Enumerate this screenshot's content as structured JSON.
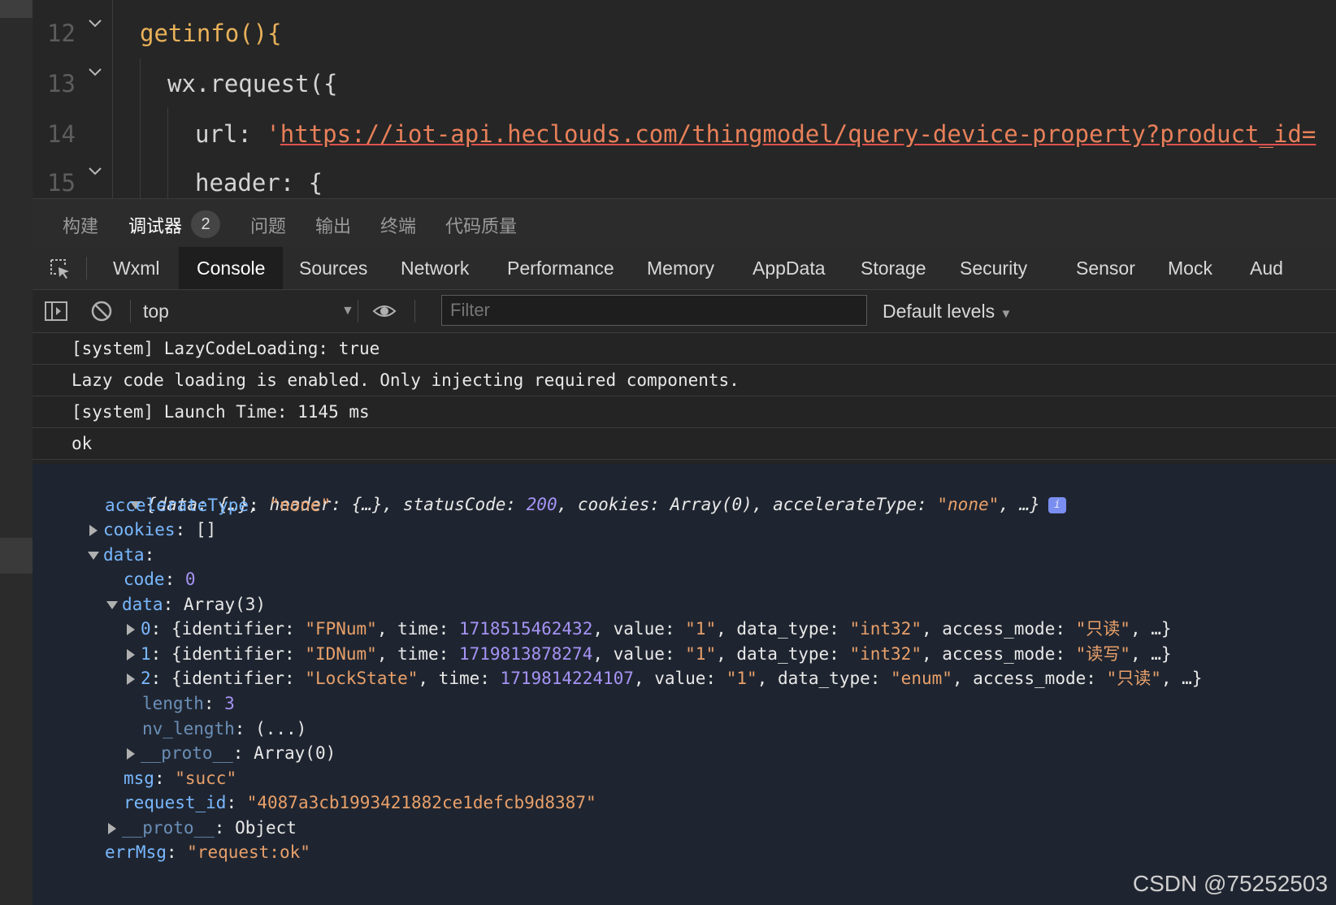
{
  "editor": {
    "lines": [
      {
        "num": "12",
        "code": "getinfo(){"
      },
      {
        "num": "13",
        "code": "wx.request({"
      },
      {
        "num": "14",
        "code_key": "url: ",
        "code_quote": "'",
        "code_url": "https://iot-api.heclouds.com/thingmodel/query-device-property?product_id="
      },
      {
        "num": "15",
        "code": "header: {"
      }
    ]
  },
  "panel_tabs": {
    "build": "构建",
    "debugger": "调试器",
    "debugger_badge": "2",
    "problems": "问题",
    "output": "输出",
    "terminal": "终端",
    "code_quality": "代码质量"
  },
  "dev_tabs": [
    "Wxml",
    "Console",
    "Sources",
    "Network",
    "Performance",
    "Memory",
    "AppData",
    "Storage",
    "Security",
    "Sensor",
    "Mock",
    "Aud"
  ],
  "toolbar": {
    "context": "top",
    "filter_placeholder": "Filter",
    "levels": "Default levels"
  },
  "messages": [
    "[system] LazyCodeLoading: true",
    "Lazy code loading is enabled. Only injecting required components.",
    "[system] Launch Time: 1145 ms",
    "ok"
  ],
  "object": {
    "summary_pre": "{data: {…}, header: {…}, statusCode: ",
    "summary_status": "200",
    "summary_mid": ", cookies: Array(0), accelerateType: ",
    "summary_accel": "\"none\"",
    "summary_end": ", …}",
    "accelerateType_key": "accelerateType",
    "accelerateType_val": "\"none\"",
    "cookies_key": "cookies",
    "cookies_val": "[]",
    "data_key": "data",
    "code_key": "code",
    "code_val": "0",
    "inner_data_key": "data",
    "inner_data_val": "Array(3)",
    "items": [
      {
        "idx": "0",
        "identifier": "\"FPNum\"",
        "time": "1718515462432",
        "value": "\"1\"",
        "data_type": "\"int32\"",
        "access_mode": "\"只读\""
      },
      {
        "idx": "1",
        "identifier": "\"IDNum\"",
        "time": "1719813878274",
        "value": "\"1\"",
        "data_type": "\"int32\"",
        "access_mode": "\"读写\""
      },
      {
        "idx": "2",
        "identifier": "\"LockState\"",
        "time": "1719814224107",
        "value": "\"1\"",
        "data_type": "\"enum\"",
        "access_mode": "\"只读\""
      }
    ],
    "length_key": "length",
    "length_val": "3",
    "nv_length_key": "nv_length",
    "nv_length_val": "(...)",
    "proto_key": "__proto__",
    "proto_array_val": "Array(0)",
    "msg_key": "msg",
    "msg_val": "\"succ\"",
    "request_id_key": "request_id",
    "request_id_val": "\"4087a3cb1993421882ce1defcb9d8387\"",
    "proto_object_val": "Object",
    "errMsg_key": "errMsg",
    "errMsg_val": "\"request:ok\""
  },
  "watermark": "CSDN @75252503",
  "colors": {
    "key": "#79b8ff",
    "string": "#e8a06a",
    "number": "#a593f5",
    "function": "#e8b15a"
  }
}
